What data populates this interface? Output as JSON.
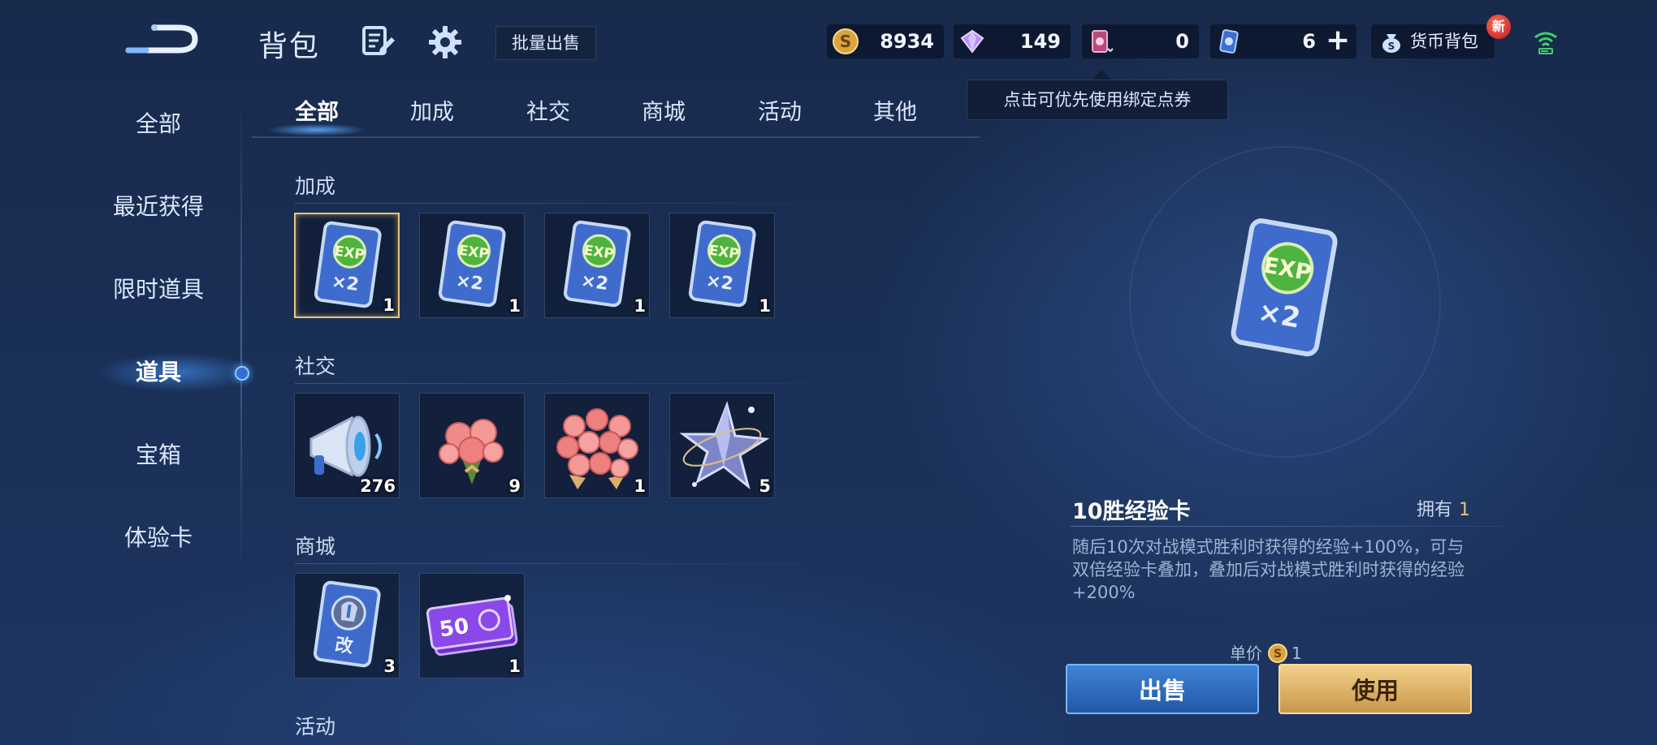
{
  "header": {
    "title": "背包",
    "bulk_sell_label": "批量出售",
    "wallet_label": "货币背包",
    "new_badge": "新"
  },
  "currencies": {
    "gold": "8934",
    "diamond": "149",
    "voucher": "0",
    "point": "6"
  },
  "tooltip": "点击可优先使用绑定点券",
  "sidebar": {
    "items": [
      {
        "label": "全部",
        "active": false
      },
      {
        "label": "最近获得",
        "active": false
      },
      {
        "label": "限时道具",
        "active": false
      },
      {
        "label": "道具",
        "active": true
      },
      {
        "label": "宝箱",
        "active": false
      },
      {
        "label": "体验卡",
        "active": false
      }
    ]
  },
  "tabs": [
    {
      "label": "全部",
      "active": true
    },
    {
      "label": "加成",
      "active": false
    },
    {
      "label": "社交",
      "active": false
    },
    {
      "label": "商城",
      "active": false
    },
    {
      "label": "活动",
      "active": false
    },
    {
      "label": "其他",
      "active": false
    }
  ],
  "sections": [
    {
      "title": "加成",
      "items": [
        {
          "icon": "exp-card-icon",
          "count": "1",
          "selected": true
        },
        {
          "icon": "exp-card-icon",
          "count": "1",
          "selected": false
        },
        {
          "icon": "exp-card-icon",
          "count": "1",
          "selected": false
        },
        {
          "icon": "exp-card-icon",
          "count": "1",
          "selected": false
        }
      ]
    },
    {
      "title": "社交",
      "items": [
        {
          "icon": "megaphone-icon",
          "count": "276"
        },
        {
          "icon": "rose-bouquet-small-icon",
          "count": "9"
        },
        {
          "icon": "rose-bouquet-large-icon",
          "count": "1"
        },
        {
          "icon": "star-charm-icon",
          "count": "5"
        }
      ]
    },
    {
      "title": "商城",
      "items": [
        {
          "icon": "rename-card-icon",
          "count": "3"
        },
        {
          "icon": "coupon-50-icon",
          "count": "1",
          "coupon_text": "50"
        }
      ]
    },
    {
      "title": "活动",
      "items": []
    }
  ],
  "detail": {
    "name": "10胜经验卡",
    "owned_label": "拥有",
    "owned_count": "1",
    "description": "随后10次对战模式胜利时获得的经验+100%，可与双倍经验卡叠加，叠加后对战模式胜利时获得的经验+200%",
    "unit_price_label": "单价",
    "unit_price": "1",
    "sell_label": "出售",
    "use_label": "使用"
  },
  "card_text": {
    "exp": "EXP",
    "multiplier": "×2",
    "rename": "改"
  },
  "colors": {
    "accent_gold": "#e7c37a",
    "accent_blue": "#3f83d6",
    "background": "#1a2f56"
  }
}
